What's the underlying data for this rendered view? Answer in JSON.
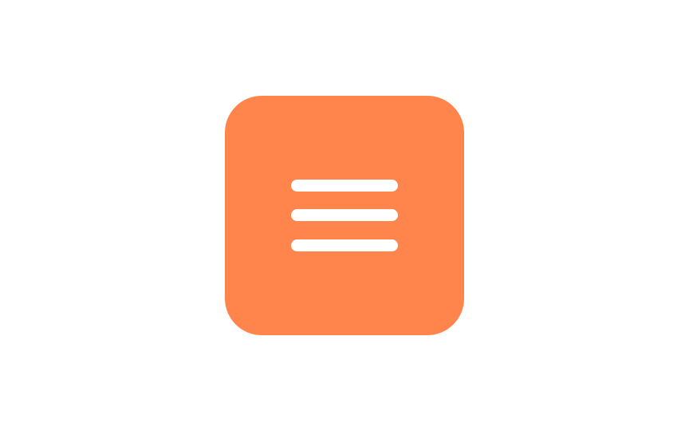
{
  "menu_button": {
    "icon": "hamburger-menu-icon",
    "background_color": "#ff854d",
    "icon_color": "#ffffff",
    "bar_count": 3
  }
}
